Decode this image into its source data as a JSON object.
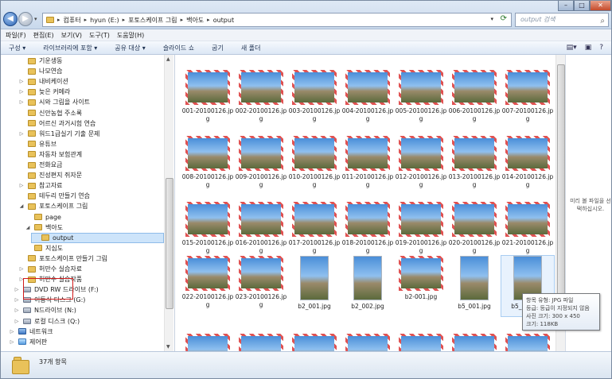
{
  "address": {
    "crumbs": [
      "컴퓨터",
      "hyun (E:)",
      "포토스케이프 그림",
      "백아도",
      "output"
    ],
    "search_placeholder": "output 검색"
  },
  "menu": [
    "파일(F)",
    "편집(E)",
    "보기(V)",
    "도구(T)",
    "도움말(H)"
  ],
  "toolbar": [
    "구성 ▾",
    "라이브러리에 포함 ▾",
    "공유 대상 ▾",
    "슬라이드 쇼",
    "굽기",
    "새 폴더"
  ],
  "tree": [
    {
      "label": "기운생동",
      "indent": 1,
      "icon": "folder",
      "exp": ""
    },
    {
      "label": "나모연습",
      "indent": 1,
      "icon": "folder",
      "exp": ""
    },
    {
      "label": "내비케이션",
      "indent": 1,
      "icon": "folder",
      "exp": "▷"
    },
    {
      "label": "늦은 커메라",
      "indent": 1,
      "icon": "folder",
      "exp": "▷"
    },
    {
      "label": "시와 그림을 사이트",
      "indent": 1,
      "icon": "folder",
      "exp": "▷"
    },
    {
      "label": "신안농협 주소록",
      "indent": 1,
      "icon": "folder",
      "exp": ""
    },
    {
      "label": "어르신 과거시험 연습",
      "indent": 1,
      "icon": "folder",
      "exp": ""
    },
    {
      "label": "워드1급실기 기출 문제",
      "indent": 1,
      "icon": "folder",
      "exp": "▷"
    },
    {
      "label": "유튜브",
      "indent": 1,
      "icon": "folder",
      "exp": ""
    },
    {
      "label": "자동차 보험관계",
      "indent": 1,
      "icon": "folder",
      "exp": ""
    },
    {
      "label": "전화요금",
      "indent": 1,
      "icon": "folder",
      "exp": ""
    },
    {
      "label": "진성편지 쥐자문",
      "indent": 1,
      "icon": "folder",
      "exp": ""
    },
    {
      "label": "참고자료",
      "indent": 1,
      "icon": "folder",
      "exp": "▷"
    },
    {
      "label": "테두리 만들기 연습",
      "indent": 1,
      "icon": "folder",
      "exp": ""
    },
    {
      "label": "포토스케이프 그림",
      "indent": 1,
      "icon": "folder",
      "exp": "◢"
    },
    {
      "label": "page",
      "indent": 2,
      "icon": "folder",
      "exp": ""
    },
    {
      "label": "백아도",
      "indent": 2,
      "icon": "folder",
      "exp": "◢"
    },
    {
      "label": "output",
      "indent": 3,
      "icon": "folder",
      "exp": "",
      "selected": true
    },
    {
      "label": "지심도",
      "indent": 2,
      "icon": "folder",
      "exp": ""
    },
    {
      "label": "포토스케이프 만들기 그림",
      "indent": 1,
      "icon": "folder",
      "exp": ""
    },
    {
      "label": "허만수 실습자료",
      "indent": 1,
      "icon": "folder",
      "exp": "▷"
    },
    {
      "label": "허만수 실습작품",
      "indent": 1,
      "icon": "folder",
      "exp": "▷"
    },
    {
      "label": "DVD RW 드라이브 (F:)",
      "indent": 0,
      "icon": "drive",
      "exp": "▷"
    },
    {
      "label": "이동식 디스크 (G:)",
      "indent": 0,
      "icon": "drive",
      "exp": "▷"
    },
    {
      "label": "N드라이브 (N:)",
      "indent": 0,
      "icon": "drive",
      "exp": "▷"
    },
    {
      "label": "로컬 디스크 (Q:)",
      "indent": 0,
      "icon": "drive",
      "exp": "▷"
    },
    {
      "label": "네트워크",
      "indent": -1,
      "icon": "net",
      "exp": "▷"
    },
    {
      "label": "제어판",
      "indent": -1,
      "icon": "ctrl",
      "exp": "▷"
    }
  ],
  "files": [
    {
      "name": "001-20100126.jpg",
      "style": "frame"
    },
    {
      "name": "002-20100126.jpg",
      "style": "frame"
    },
    {
      "name": "003-20100126.jpg",
      "style": "frame"
    },
    {
      "name": "004-20100126.jpg",
      "style": "frame"
    },
    {
      "name": "005-20100126.jpg",
      "style": "frame"
    },
    {
      "name": "006-20100126.jpg",
      "style": "frame"
    },
    {
      "name": "007-20100126.jpg",
      "style": "frame"
    },
    {
      "name": "008-20100126.jpg",
      "style": "frame"
    },
    {
      "name": "009-20100126.jpg",
      "style": "frame"
    },
    {
      "name": "010-20100126.jpg",
      "style": "frame"
    },
    {
      "name": "011-20100126.jpg",
      "style": "frame"
    },
    {
      "name": "012-20100126.jpg",
      "style": "frame"
    },
    {
      "name": "013-20100126.jpg",
      "style": "frame"
    },
    {
      "name": "014-20100126.jpg",
      "style": "frame"
    },
    {
      "name": "015-20100126.jpg",
      "style": "frame"
    },
    {
      "name": "016-20100126.jpg",
      "style": "frame"
    },
    {
      "name": "017-20100126.jpg",
      "style": "frame"
    },
    {
      "name": "018-20100126.jpg",
      "style": "frame"
    },
    {
      "name": "019-20100126.jpg",
      "style": "frame"
    },
    {
      "name": "020-20100126.jpg",
      "style": "frame"
    },
    {
      "name": "021-20100126.jpg",
      "style": "frame"
    },
    {
      "name": "022-20100126.jpg",
      "style": "frame"
    },
    {
      "name": "023-20100126.jpg",
      "style": "frame"
    },
    {
      "name": "b2_001.jpg",
      "style": "portrait"
    },
    {
      "name": "b2_002.jpg",
      "style": "portrait"
    },
    {
      "name": "b2-001.jpg",
      "style": "frame"
    },
    {
      "name": "b5_001.jpg",
      "style": "portrait"
    },
    {
      "name": "b5_002.jpg",
      "style": "portrait",
      "hovered": true
    },
    {
      "name": "",
      "style": "frame"
    },
    {
      "name": "",
      "style": "frame"
    },
    {
      "name": "",
      "style": "frame"
    },
    {
      "name": "",
      "style": "frame"
    },
    {
      "name": "",
      "style": "frame"
    },
    {
      "name": "",
      "style": "frame"
    },
    {
      "name": "",
      "style": "frame"
    }
  ],
  "preview_message": "미리 볼 파일을 선택하십시오.",
  "tooltip": {
    "type": "항목 유형: JPG 파일",
    "rating": "등급: 등급이 지정되지 않음",
    "dims": "사진 크기: 300 x 450",
    "size": "크기: 118KB"
  },
  "status": {
    "count": "37개 항목"
  },
  "colors": {
    "frame_red": "#e05252",
    "selection": "#cde4fa",
    "highlight": "#d21a1a"
  }
}
